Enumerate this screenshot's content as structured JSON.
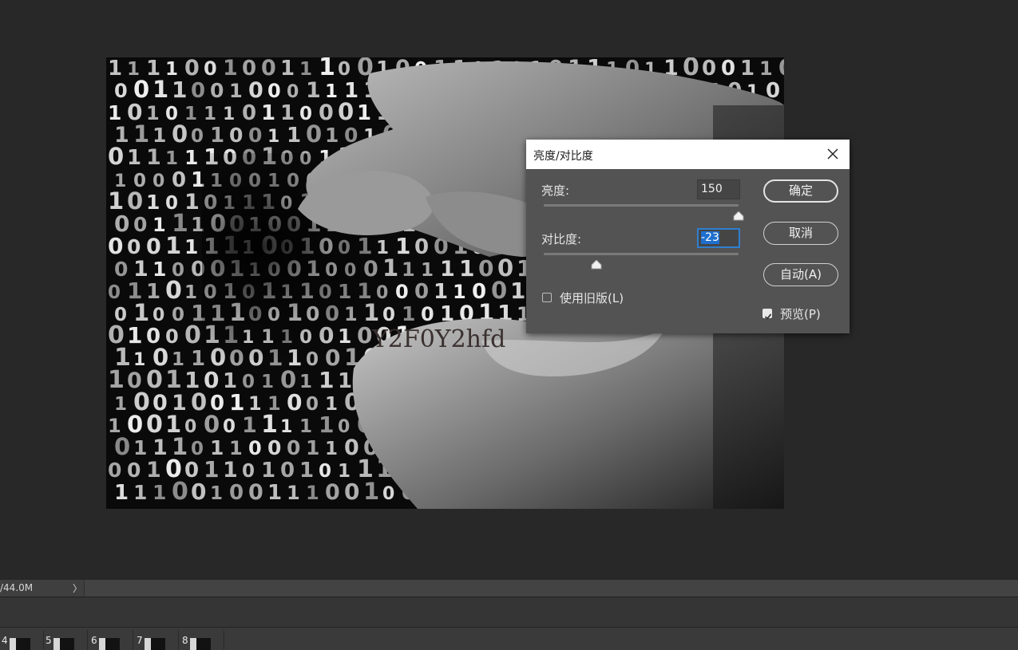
{
  "status_bar": {
    "doc_size": "/44.0M",
    "expand_arrow": "〉"
  },
  "canvas": {
    "watermark_text": "Y2F0Y2hfd"
  },
  "dialog": {
    "title": "亮度/对比度",
    "brightness_label": "亮度:",
    "brightness_value": "150",
    "brightness_level": 1.0,
    "contrast_label": "对比度:",
    "contrast_value": "-23",
    "contrast_level": 0.27,
    "legacy_checkbox_label": "使用旧版(L)",
    "legacy_checked": false,
    "ok_label": "确定",
    "cancel_label": "取消",
    "auto_label": "自动(A)",
    "preview_label": "预览(P)",
    "preview_checked": true,
    "close_icon": "close-icon"
  },
  "timeline": {
    "frames": [
      "4",
      "5",
      "6",
      "7",
      "8"
    ]
  }
}
